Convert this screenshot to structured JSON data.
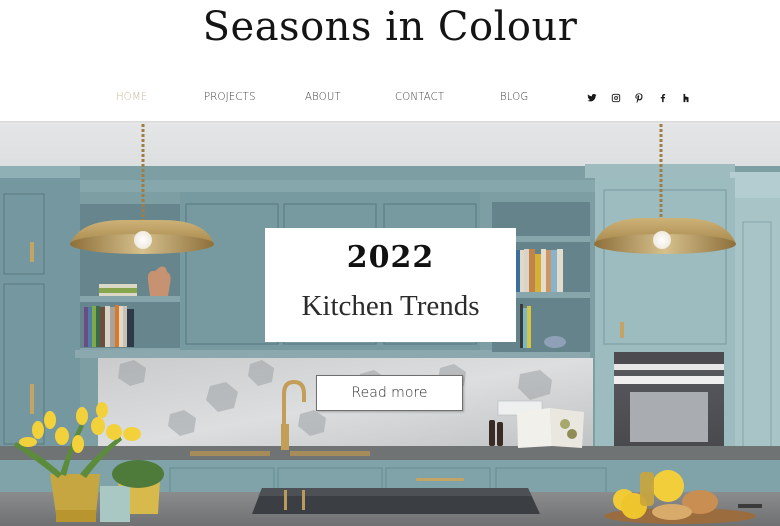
{
  "site": {
    "title": "Seasons in Colour"
  },
  "nav": {
    "items": [
      {
        "label": "HOME",
        "active": true
      },
      {
        "label": "PROJECTS",
        "active": false
      },
      {
        "label": "ABOUT",
        "active": false
      },
      {
        "label": "CONTACT",
        "active": false
      },
      {
        "label": "BLOG",
        "active": false
      }
    ],
    "active_color": "#c8b79a",
    "text_color": "#3a3a3a"
  },
  "social": [
    {
      "name": "twitter-icon"
    },
    {
      "name": "instagram-icon"
    },
    {
      "name": "pinterest-icon"
    },
    {
      "name": "facebook-icon"
    },
    {
      "name": "houzz-icon"
    }
  ],
  "hero": {
    "image_description": "Blue-grey shaker kitchen with brass pendant lights, open shelving with books, marble hexagon backsplash, brass tap, built-in oven, yellow tulips in brass pots and lemons on a wooden board",
    "banner": {
      "year": "2022",
      "title": "Kitchen Trends"
    },
    "cta_label": "Read more",
    "colors": {
      "cabinet": "#7b9ca1",
      "cabinet_light": "#a7c3c7",
      "brass": "#c4a464",
      "ceiling": "#e4e5e5",
      "worktop": "#7d7f80"
    }
  }
}
